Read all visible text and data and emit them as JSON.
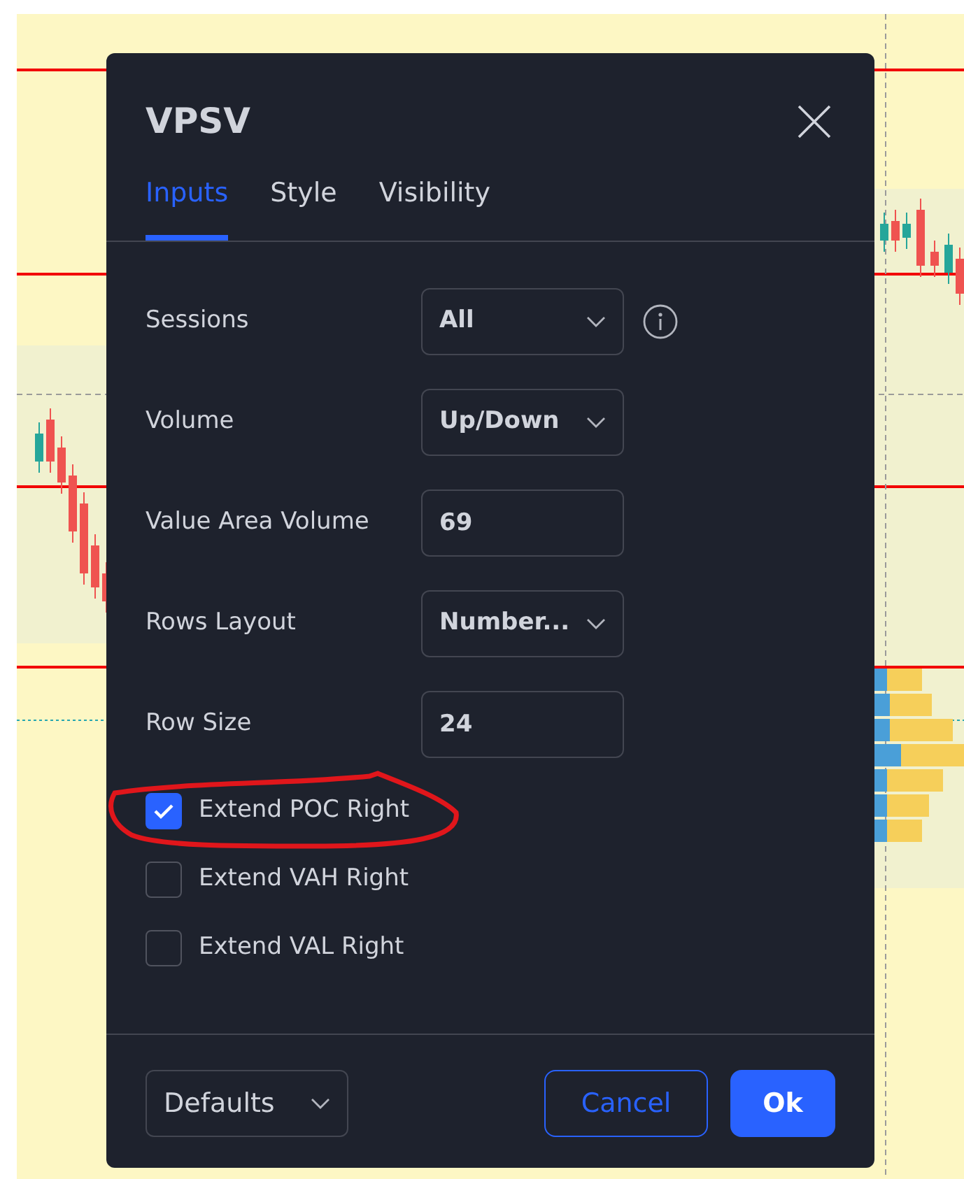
{
  "dialog": {
    "title": "VPSV",
    "tabs": [
      {
        "label": "Inputs",
        "selected": true
      },
      {
        "label": "Style",
        "selected": false
      },
      {
        "label": "Visibility",
        "selected": false
      }
    ],
    "fields": [
      {
        "label": "Sessions",
        "kind": "select",
        "value": "All",
        "info": true
      },
      {
        "label": "Volume",
        "kind": "select",
        "value": "Up/Down",
        "info": false
      },
      {
        "label": "Value Area Volume",
        "kind": "number",
        "value": "69",
        "info": false
      },
      {
        "label": "Rows Layout",
        "kind": "select",
        "value": "Number...",
        "info": false
      },
      {
        "label": "Row Size",
        "kind": "number",
        "value": "24",
        "info": false
      }
    ],
    "checkboxes": [
      {
        "label": "Extend POC Right",
        "checked": true,
        "highlighted": true
      },
      {
        "label": "Extend VAH Right",
        "checked": false,
        "highlighted": false
      },
      {
        "label": "Extend VAL Right",
        "checked": false,
        "highlighted": false
      }
    ],
    "footer": {
      "defaults": "Defaults",
      "cancel": "Cancel",
      "ok": "Ok"
    }
  }
}
